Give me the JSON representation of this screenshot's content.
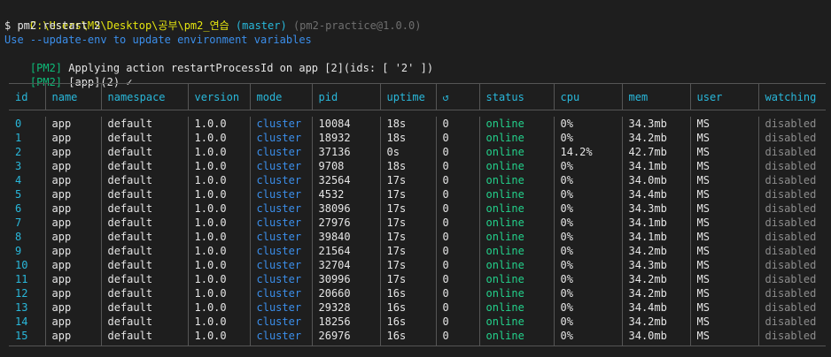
{
  "prompt": {
    "path": "C:\\Users\\MS\\Desktop\\공부\\pm2_연습",
    "branch": " (master)",
    "package": " (pm2-practice@1.0.0)"
  },
  "command": "$ pm2 restart 2",
  "info_line": "Use --update-env to update environment variables",
  "log_lines": [
    {
      "tag": "[PM2]",
      "text": " Applying action restartProcessId on app [2](ids: [ '2' ])"
    },
    {
      "tag": "[PM2]",
      "text": " [app](2) ✓"
    }
  ],
  "table": {
    "headers": [
      "id",
      "name",
      "namespace",
      "version",
      "mode",
      "pid",
      "uptime",
      "↺",
      "status",
      "cpu",
      "mem",
      "user",
      "watching"
    ],
    "rows": [
      [
        "0",
        "app",
        "default",
        "1.0.0",
        "cluster",
        "10084",
        "18s",
        "0",
        "online",
        "0%",
        "34.3mb",
        "MS",
        "disabled"
      ],
      [
        "1",
        "app",
        "default",
        "1.0.0",
        "cluster",
        "18932",
        "18s",
        "0",
        "online",
        "0%",
        "34.2mb",
        "MS",
        "disabled"
      ],
      [
        "2",
        "app",
        "default",
        "1.0.0",
        "cluster",
        "37136",
        "0s",
        "0",
        "online",
        "14.2%",
        "42.7mb",
        "MS",
        "disabled"
      ],
      [
        "3",
        "app",
        "default",
        "1.0.0",
        "cluster",
        "9708",
        "18s",
        "0",
        "online",
        "0%",
        "34.1mb",
        "MS",
        "disabled"
      ],
      [
        "4",
        "app",
        "default",
        "1.0.0",
        "cluster",
        "32564",
        "17s",
        "0",
        "online",
        "0%",
        "34.0mb",
        "MS",
        "disabled"
      ],
      [
        "5",
        "app",
        "default",
        "1.0.0",
        "cluster",
        "4532",
        "17s",
        "0",
        "online",
        "0%",
        "34.4mb",
        "MS",
        "disabled"
      ],
      [
        "6",
        "app",
        "default",
        "1.0.0",
        "cluster",
        "38096",
        "17s",
        "0",
        "online",
        "0%",
        "34.3mb",
        "MS",
        "disabled"
      ],
      [
        "7",
        "app",
        "default",
        "1.0.0",
        "cluster",
        "27976",
        "17s",
        "0",
        "online",
        "0%",
        "34.1mb",
        "MS",
        "disabled"
      ],
      [
        "8",
        "app",
        "default",
        "1.0.0",
        "cluster",
        "39840",
        "17s",
        "0",
        "online",
        "0%",
        "34.1mb",
        "MS",
        "disabled"
      ],
      [
        "9",
        "app",
        "default",
        "1.0.0",
        "cluster",
        "21564",
        "17s",
        "0",
        "online",
        "0%",
        "34.2mb",
        "MS",
        "disabled"
      ],
      [
        "10",
        "app",
        "default",
        "1.0.0",
        "cluster",
        "32704",
        "17s",
        "0",
        "online",
        "0%",
        "34.3mb",
        "MS",
        "disabled"
      ],
      [
        "11",
        "app",
        "default",
        "1.0.0",
        "cluster",
        "30996",
        "17s",
        "0",
        "online",
        "0%",
        "34.2mb",
        "MS",
        "disabled"
      ],
      [
        "12",
        "app",
        "default",
        "1.0.0",
        "cluster",
        "20660",
        "16s",
        "0",
        "online",
        "0%",
        "34.2mb",
        "MS",
        "disabled"
      ],
      [
        "13",
        "app",
        "default",
        "1.0.0",
        "cluster",
        "29328",
        "16s",
        "0",
        "online",
        "0%",
        "34.4mb",
        "MS",
        "disabled"
      ],
      [
        "14",
        "app",
        "default",
        "1.0.0",
        "cluster",
        "18256",
        "16s",
        "0",
        "online",
        "0%",
        "34.2mb",
        "MS",
        "disabled"
      ],
      [
        "15",
        "app",
        "default",
        "1.0.0",
        "cluster",
        "26976",
        "16s",
        "0",
        "online",
        "0%",
        "34.0mb",
        "MS",
        "disabled"
      ]
    ]
  },
  "colors": {
    "background": "#1e1e1e",
    "prompt_path": "#e5e510",
    "info": "#3b8eea",
    "pm2_tag": "#0dbc79",
    "header": "#29b8db",
    "mode": "#3b8eea",
    "status_online": "#23d18b",
    "watching": "#8c8c8c",
    "border": "#555555"
  }
}
